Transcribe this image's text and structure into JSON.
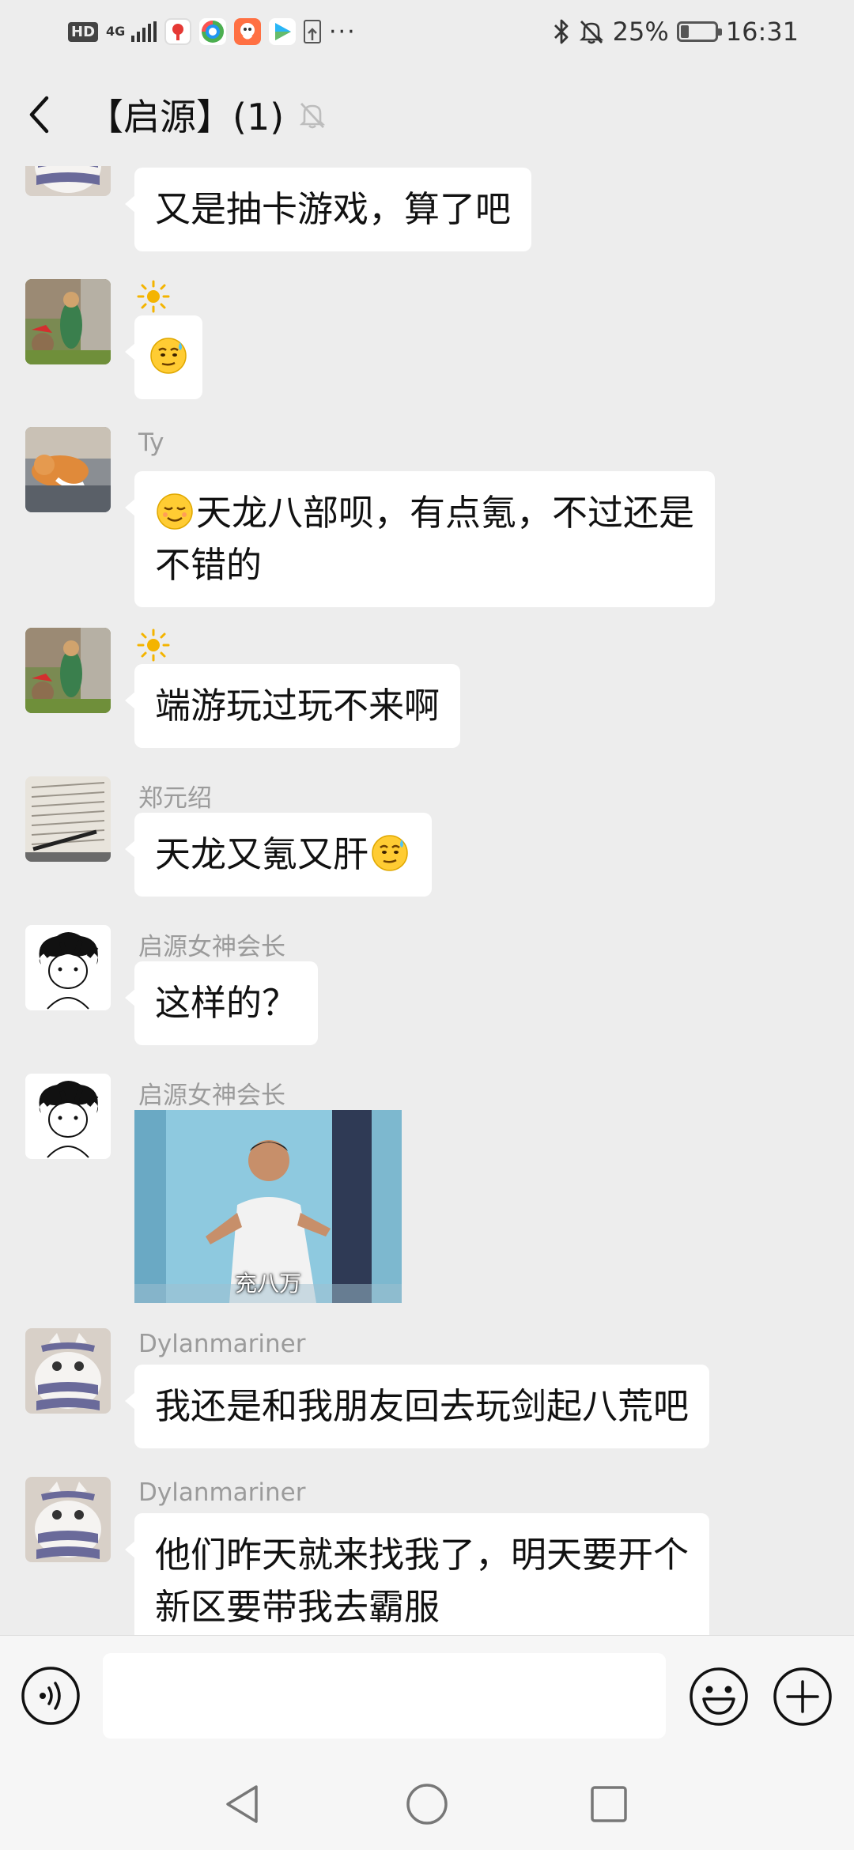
{
  "status_bar": {
    "hd": "HD",
    "network": "4G",
    "more": "···",
    "battery": "25%",
    "battery_level": 0.25,
    "time": "16:31"
  },
  "header": {
    "title": "【启源】(1)"
  },
  "messages": [
    {
      "sender": "",
      "text": "又是抽卡游戏，算了吧"
    },
    {
      "sender": "",
      "emoji_name": "sweat-smile-emoji"
    },
    {
      "sender": "Ty",
      "lines": [
        "天龙八部呗，有点氪，不过还是",
        "不错的"
      ],
      "emoji_name": "sly-smile-emoji"
    },
    {
      "sender": "",
      "text": "端游玩过玩不来啊"
    },
    {
      "sender": "郑元绍",
      "text": "天龙又氪又肝",
      "emoji_name": "sweat-smile-emoji"
    },
    {
      "sender": "启源女神会长",
      "text": "这样的？"
    },
    {
      "sender": "启源女神会长",
      "gif_caption": "充八万"
    },
    {
      "sender": "Dylanmariner",
      "text": "我还是和我朋友回去玩剑起八荒吧"
    },
    {
      "sender": "Dylanmariner",
      "lines": [
        "他们昨天就来找我了，明天要开个",
        "新区要带我去霸服"
      ]
    }
  ],
  "input": {
    "value": "",
    "placeholder": ""
  },
  "colors": {
    "background": "#ededed",
    "bubble": "#ffffff",
    "sender_name": "#9b9b9b",
    "input_bar": "#f6f6f6"
  }
}
